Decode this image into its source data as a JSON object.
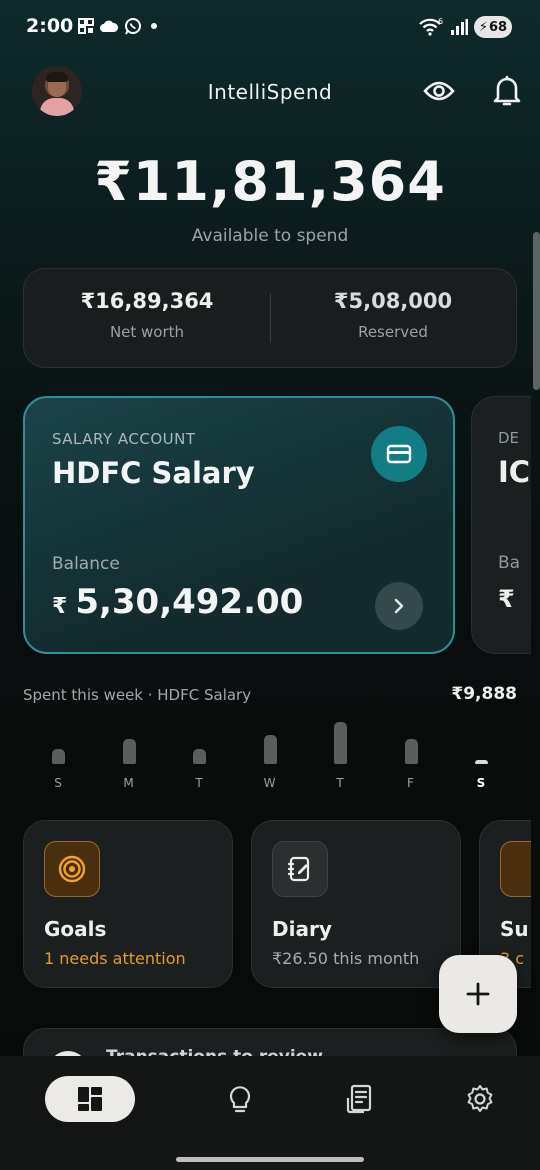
{
  "status_bar": {
    "time": "2:00",
    "left_icons": [
      "qr-icon",
      "cloud-icon",
      "whatsapp-icon",
      "dot-icon"
    ],
    "wifi_label": "6",
    "battery": "68"
  },
  "header": {
    "title": "IntelliSpend"
  },
  "balance": {
    "amount": "₹11,81,364",
    "label": "Available to spend"
  },
  "summary": {
    "net_worth_value": "₹16,89,364",
    "net_worth_label": "Net worth",
    "reserved_value": "₹5,08,000",
    "reserved_label": "Reserved"
  },
  "accounts": [
    {
      "type": "SALARY ACCOUNT",
      "name": "HDFC Salary",
      "balance_label": "Balance",
      "currency": "₹",
      "balance": "5,30,492.00"
    },
    {
      "type": "DE",
      "name": "IC",
      "balance_label": "Ba",
      "currency": "₹"
    }
  ],
  "week": {
    "label": "Spent this week · HDFC Salary",
    "total": "₹9,888",
    "days": [
      {
        "label": "S",
        "level": 0.16
      },
      {
        "label": "M",
        "level": 0.27
      },
      {
        "label": "T",
        "level": 0.16
      },
      {
        "label": "W",
        "level": 0.31
      },
      {
        "label": "T",
        "level": 0.46
      },
      {
        "label": "F",
        "level": 0.27
      },
      {
        "label": "S",
        "level": 0.04,
        "today": true
      }
    ]
  },
  "tiles": [
    {
      "title": "Goals",
      "subtitle": "1 needs attention",
      "subtitle_color": "#e79a2c",
      "icon": "target-icon"
    },
    {
      "title": "Diary",
      "subtitle": "₹26.50 this month",
      "subtitle_color": "#a6acac",
      "icon": "notebook-icon"
    },
    {
      "title": "Su",
      "subtitle": "3 c",
      "subtitle_color": "#e79a2c",
      "icon": "subscription-icon"
    }
  ],
  "review": {
    "text": "Transactions to review"
  },
  "colors": {
    "accent": "#137d86",
    "card_border": "#2e8f96",
    "warning": "#e79a2c"
  },
  "nav": [
    "dashboard-icon",
    "lightbulb-icon",
    "receipt-icon",
    "settings-icon"
  ]
}
